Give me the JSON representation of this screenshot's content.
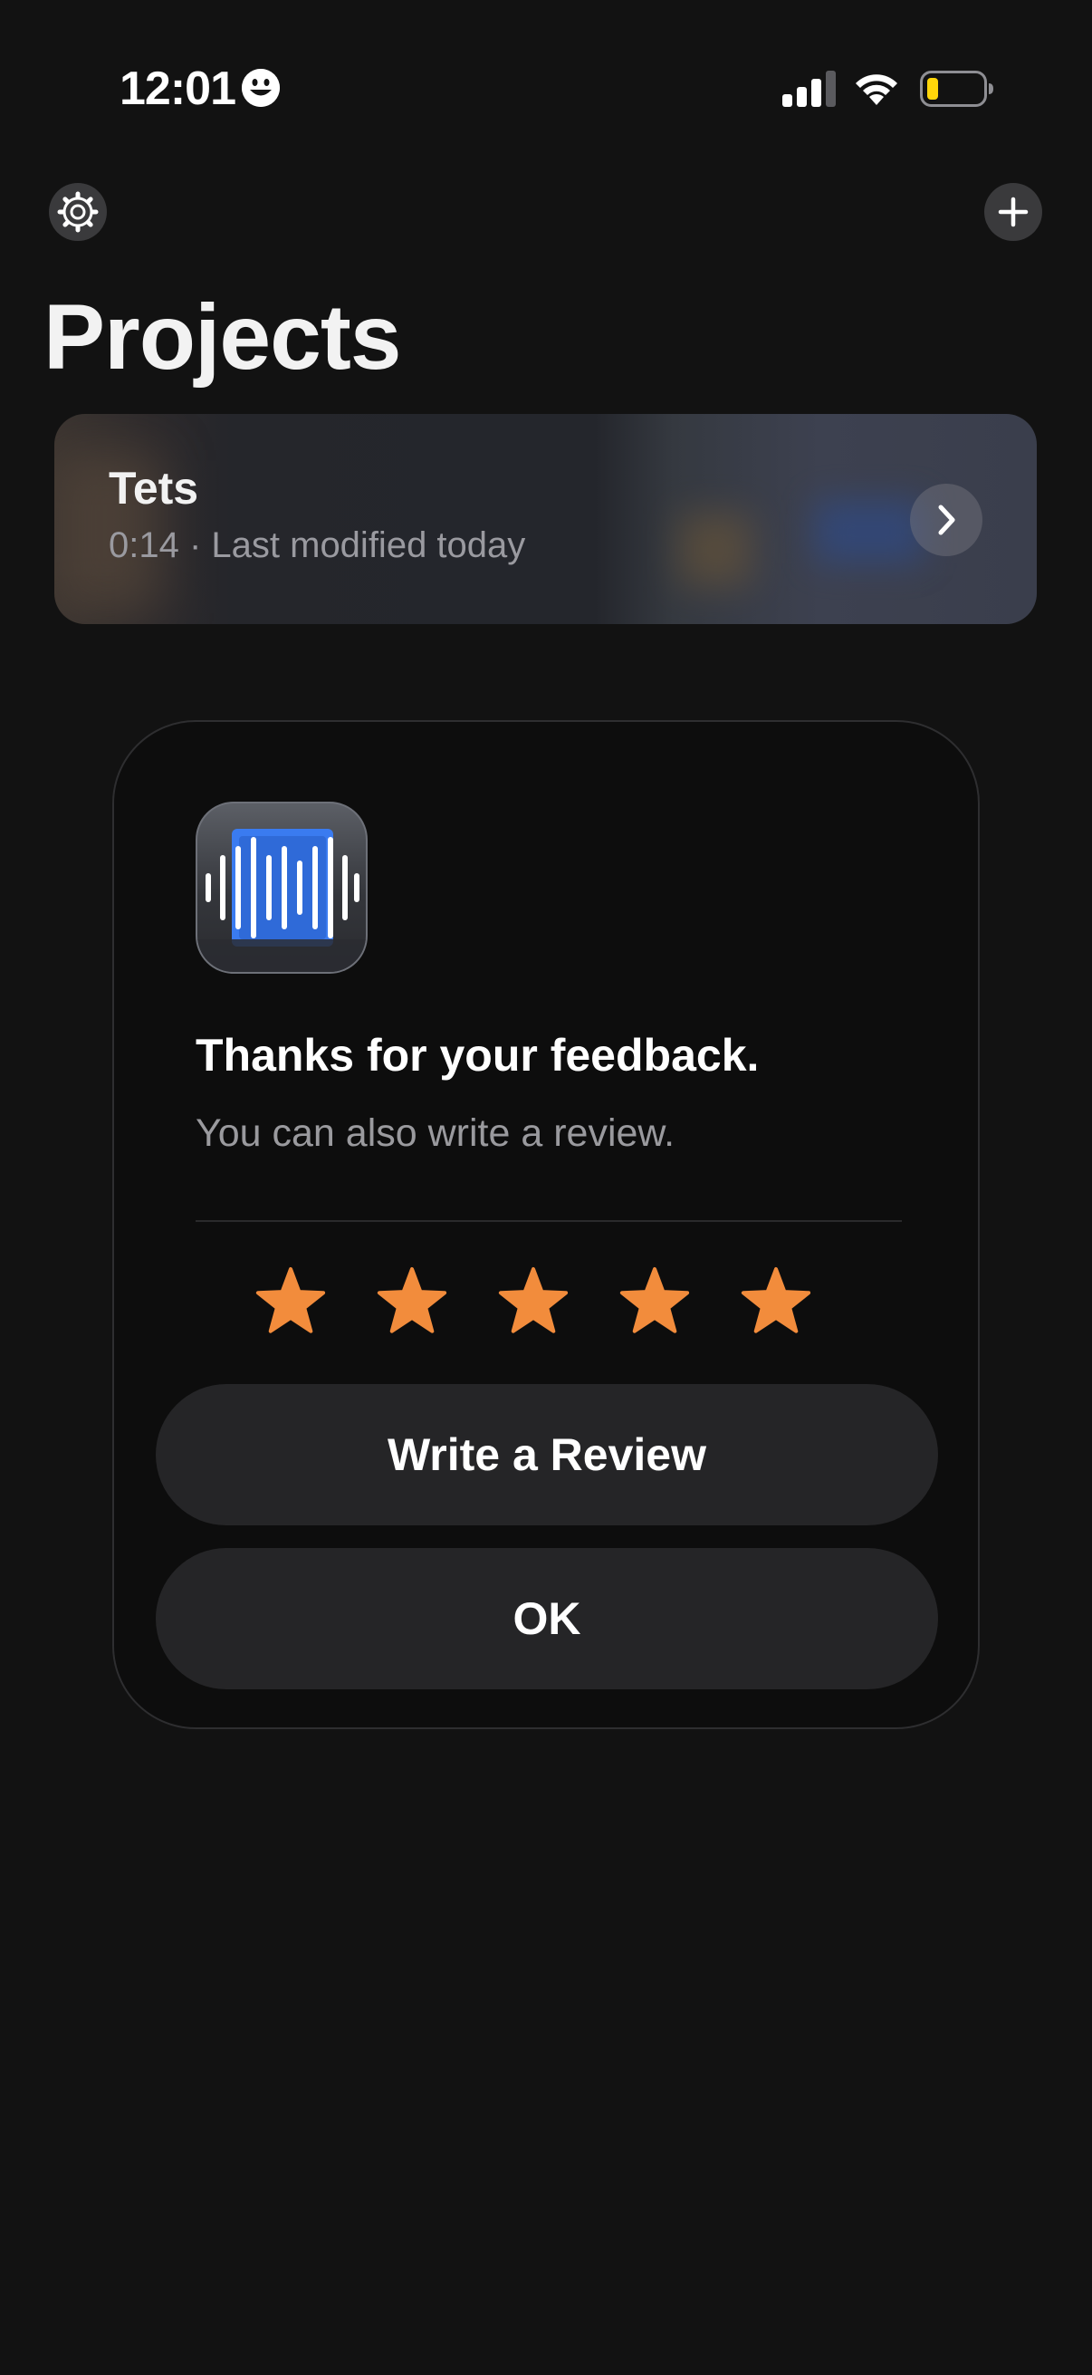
{
  "status_bar": {
    "time": "12:01",
    "emoji_icon": "smiley-face-icon",
    "signal_icon": "cellular-signal-icon",
    "wifi_icon": "wifi-icon",
    "battery_icon": "battery-low-icon",
    "battery_color": "#ffd60a"
  },
  "header": {
    "settings_icon": "gear-icon",
    "add_icon": "plus-icon",
    "title": "Projects"
  },
  "projects": [
    {
      "name": "Tets",
      "meta": "0:14 · Last modified today",
      "chevron_icon": "chevron-right-icon"
    }
  ],
  "dialog": {
    "app_icon": "waveform-app-icon",
    "title": "Thanks for your feedback.",
    "subtitle": "You can also write a review.",
    "rating": 5,
    "rating_max": 5,
    "star_color": "#f28c3c",
    "write_review_label": "Write a Review",
    "ok_label": "OK"
  },
  "colors": {
    "background": "#121212",
    "button": "#252527",
    "accent_blue": "#3a7bf0"
  }
}
